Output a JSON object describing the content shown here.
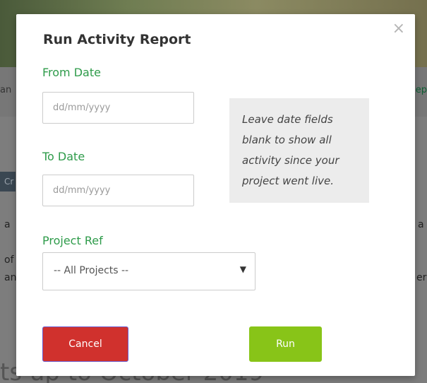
{
  "background": {
    "nav_left_text": "an",
    "nav_right_text": "ep",
    "chip_text": "Cr",
    "line_texts": [
      "a",
      "a",
      "of",
      "an",
      "er"
    ],
    "footer_text": "ts up to October 2019"
  },
  "modal": {
    "title": "Run Activity Report",
    "close_glyph": "×",
    "from_date": {
      "label": "From Date",
      "placeholder": "dd/mm/yyyy",
      "value": ""
    },
    "to_date": {
      "label": "To Date",
      "placeholder": "dd/mm/yyyy",
      "value": ""
    },
    "hint": "Leave date fields blank to show all activity since your project went live.",
    "project_ref": {
      "label": "Project Ref",
      "selected": "-- All Projects --",
      "caret_glyph": "▼"
    },
    "buttons": {
      "cancel": "Cancel",
      "run": "Run"
    }
  },
  "colors": {
    "label_green": "#2e9b4a",
    "cancel_red": "#d0312d",
    "run_green": "#88c418",
    "overlay_gray": "#7f7f7f"
  }
}
